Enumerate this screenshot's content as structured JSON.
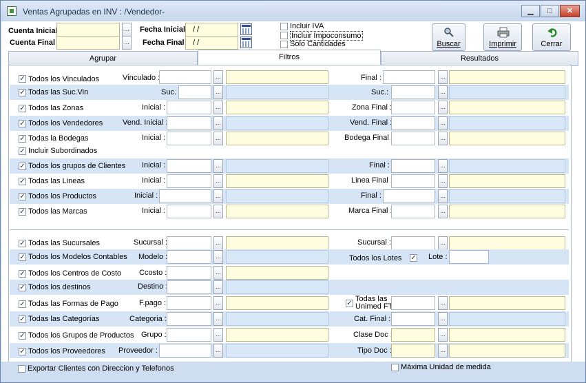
{
  "window": {
    "title": "Ventas Agrupadas en INV :  /Vendedor-",
    "min_label": "▁",
    "max_label": "□",
    "close_label": "✕"
  },
  "header": {
    "cuenta_inicial": "Cuenta Inicial :",
    "cuenta_final": "Cuenta Final :",
    "fecha_inicial": "Fecha Inicial :",
    "fecha_final": "Fecha Final :",
    "fecha_inicial_value": " / /",
    "fecha_final_value": " / /",
    "incluir_iva": "Incluir IVA",
    "incluir_impoconsumo": "Incluir Impoconsumo",
    "solo_cantidades": "Solo Cantidades",
    "buscar": "Buscar",
    "imprimir": "Imprimir",
    "cerrar": "Cerrar"
  },
  "tabs": [
    "Agrupar",
    "Filtros",
    "Resultados"
  ],
  "rows": [
    {
      "check": "Todos los Vinculados",
      "field": "Vinculado :",
      "right": "Final :"
    },
    {
      "check": "Todas las Suc.Vin",
      "field": "Suc.",
      "right": "Suc.:"
    },
    {
      "check": "Todos las Zonas",
      "field": "Inicial :",
      "right": "Zona Final :"
    },
    {
      "check": "Todos los Vendedores",
      "field": "Vend. Inicial :",
      "right": "Vend. Final :"
    },
    {
      "check": "Todas la Bodegas",
      "field": "Inicial :",
      "right": "Bodega Final :"
    },
    {
      "check": "Incluir Subordinados"
    },
    {
      "check": "Todos los grupos de Clientes",
      "field": "Inicial :",
      "right": "Final :"
    },
    {
      "check": "Todas las Lineas",
      "field": "Inicial :",
      "right": "Linea Final :"
    },
    {
      "check": "Todos los Productos",
      "field": "Inicial :",
      "right": "Final :"
    },
    {
      "check": "Todos las Marcas",
      "field": "Inicial :",
      "right": "Marca Final :"
    },
    {
      "check": "Todas las Sucursales",
      "field": "Sucursal :",
      "right": "Sucursal :"
    },
    {
      "check": "Todos los Modelos Contables",
      "field": "Modelo :",
      "right": "Todos los Lotes",
      "right2": "Lote :"
    },
    {
      "check": "Todos los Centros de Costo",
      "field": "Ccosto :"
    },
    {
      "check": "Todos los destinos",
      "field": "Destino :"
    },
    {
      "check": "Todas las Formas de Pago",
      "field": "F.pago :",
      "right": "Todas las Unimed FT"
    },
    {
      "check": "Todas las Categorías",
      "field": "Categoria :",
      "right": "Cat. Final :"
    },
    {
      "check": "Todos los Grupos de Productos",
      "field": "Grupo :",
      "right": "Clase Doc :"
    },
    {
      "check": "Todos los Proveedores",
      "field": "Proveedor :",
      "right": "Tipo Doc :"
    }
  ],
  "footer": {
    "exportar": "Exportar Clientes con Direccion y Telefonos",
    "maxima": "Máxima Unidad de medida"
  },
  "colors": {
    "row_alt": "#d6e5f6",
    "highlight_input": "#fffde0"
  }
}
